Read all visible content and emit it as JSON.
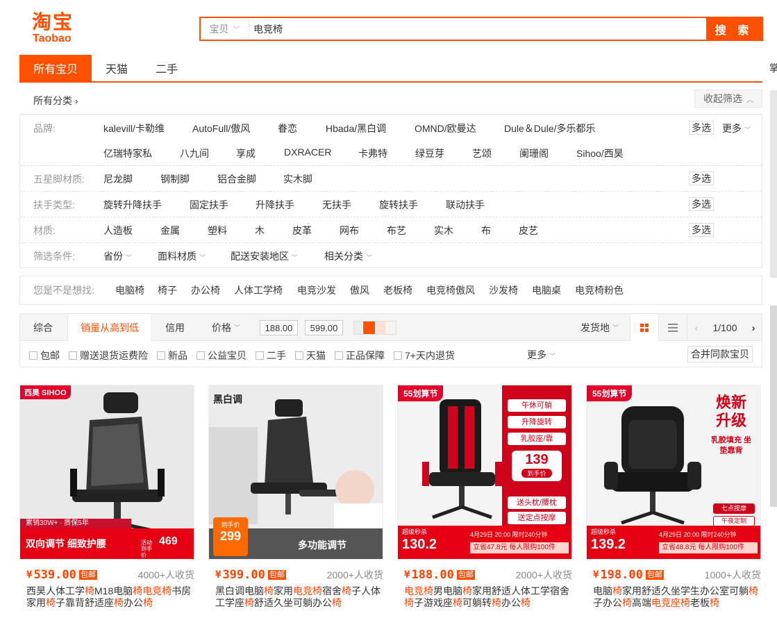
{
  "header": {
    "logo_cn": "淘宝",
    "logo_en": "Taobao",
    "search_scope": "宝贝",
    "search_query": "电竞椅",
    "search_button": "搜 索"
  },
  "tabs": [
    "所有宝贝",
    "天猫",
    "二手"
  ],
  "right_edge_text": "掌",
  "category": {
    "all_label": "所有分类 ›",
    "collapse_label": "收起筛选"
  },
  "filters": {
    "brand_label": "品牌:",
    "brands_row1": [
      "kalevill/卡勒维",
      "AutoFull/傲风",
      "眷恋",
      "Hbada/黑白调",
      "OMND/欧曼达",
      "Dule＆Dule/多乐都乐"
    ],
    "brands_row2": [
      "亿瑞特家私",
      "八九间",
      "享成",
      "DXRACER",
      "卡弗特",
      "绿豆芽",
      "艺颂",
      "阑珊阁",
      "Sihoo/西昊"
    ],
    "leg_label": "五星脚材质:",
    "legs": [
      "尼龙脚",
      "钢制脚",
      "铝合金脚",
      "实木脚"
    ],
    "armrest_label": "扶手类型:",
    "armrests": [
      "旋转升降扶手",
      "固定扶手",
      "升降扶手",
      "无扶手",
      "旋转扶手",
      "联动扶手"
    ],
    "material_label": "材质:",
    "materials": [
      "人造板",
      "金属",
      "塑料",
      "木",
      "皮革",
      "网布",
      "布艺",
      "实木",
      "布",
      "皮艺"
    ],
    "cond_label": "筛选条件:",
    "conditions": [
      "省份",
      "面料材质",
      "配送安装地区",
      "相关分类"
    ],
    "multi_label": "多选",
    "more_label": "更多"
  },
  "suggest": {
    "label": "您是不是想找:",
    "keywords": [
      "电脑椅",
      "椅子",
      "办公椅",
      "人体工学椅",
      "电竞沙发",
      "傲风",
      "老板椅",
      "电竞椅傲风",
      "沙发椅",
      "电脑桌",
      "电竞椅粉色"
    ]
  },
  "sort": {
    "options": [
      "综合",
      "销量从高到低",
      "信用",
      "价格"
    ],
    "price_min": "188.00",
    "price_max": "599.00",
    "ship_from": "发货地",
    "page": "1/100"
  },
  "checks": [
    "包邮",
    "赠送退货运费险",
    "新品",
    "公益宝贝",
    "二手",
    "天猫",
    "正品保障",
    "7+天内退货"
  ],
  "checks_more": "更多",
  "merge_button": "合并同款宝贝",
  "products": [
    {
      "price": "539.00",
      "tag": "包邮",
      "sold": "4000+人收货",
      "title_parts": [
        [
          "西昊人体工学",
          0
        ],
        [
          "椅",
          1
        ],
        [
          "M18电脑",
          0
        ],
        [
          "椅",
          1
        ],
        [
          "电竞椅",
          1
        ],
        [
          "书房家用",
          0
        ],
        [
          "椅",
          1
        ],
        [
          "子靠背舒适座",
          0
        ],
        [
          "椅",
          1
        ],
        [
          "办公",
          0
        ],
        [
          "椅",
          1
        ]
      ],
      "img_brand": "西昊 SIHOO",
      "img_banner_top": "累销30W+ · 质保5年",
      "img_banner": "双向调节 细致护腰",
      "img_price": "469",
      "img_price_label": "活动到手价"
    },
    {
      "price": "399.00",
      "tag": "包邮",
      "sold": "2000+人收货",
      "title_parts": [
        [
          "黑白调电脑",
          0
        ],
        [
          "椅",
          1
        ],
        [
          "家用",
          0
        ],
        [
          "电竞椅",
          1
        ],
        [
          "宿舍",
          0
        ],
        [
          "椅",
          1
        ],
        [
          "子人体工学座",
          0
        ],
        [
          "椅",
          1
        ],
        [
          "舒适久坐可躺办公",
          0
        ],
        [
          "椅",
          1
        ]
      ],
      "img_brand": "黑白调",
      "img_price_label": "到手价",
      "img_price": "299",
      "img_banner": "多功能调节"
    },
    {
      "price": "188.00",
      "tag": "包邮",
      "sold": "2000+人收货",
      "title_parts": [
        [
          "电竞椅",
          1
        ],
        [
          "男电脑",
          0
        ],
        [
          "椅",
          1
        ],
        [
          "家用舒适人体工学宿舍",
          0
        ],
        [
          "椅",
          1
        ],
        [
          "子游戏座",
          0
        ],
        [
          "椅",
          1
        ],
        [
          "可躺转",
          0
        ],
        [
          "椅",
          1
        ],
        [
          "办公",
          0
        ],
        [
          "椅",
          1
        ]
      ],
      "img_badge": "55划算节",
      "img_pills": [
        "午休可躺",
        "升降旋转",
        "乳胶座/靠"
      ],
      "img_price": "139",
      "img_price_label": "到手价",
      "img_pills2": [
        "送头枕/腰枕",
        "送定点按摩"
      ],
      "img_flash": "超级秒杀",
      "img_flash_price": "130.2",
      "img_flash_time": "4月29日 20:00 限时240分钟",
      "img_flash_note": "立省47.8元 每人限购100件"
    },
    {
      "price": "198.00",
      "tag": "包邮",
      "sold": "1000+人收货",
      "title_parts": [
        [
          "电脑",
          0
        ],
        [
          "椅",
          1
        ],
        [
          "家用舒适久坐学生办公室可躺",
          0
        ],
        [
          "椅",
          1
        ],
        [
          "子办公",
          0
        ],
        [
          "椅",
          1
        ],
        [
          "高端",
          0
        ],
        [
          "电竞座椅",
          1
        ],
        [
          "老板",
          0
        ],
        [
          "椅",
          1
        ]
      ],
      "img_badge": "55划算节",
      "img_headline": "焕新升级",
      "img_sub": "乳胶填充 坐垫靠背",
      "img_pills": [
        "七点按摩",
        "午夜定制"
      ],
      "img_flash": "超级秒杀",
      "img_flash_price": "139.2",
      "img_flash_time": "4月29日 20:00 限时240分钟",
      "img_flash_note": "立省48.8元 每人限购100件"
    }
  ],
  "colors": {
    "accent": "#ff5000",
    "price": "#ff4400",
    "promo_red": "#e50014"
  }
}
